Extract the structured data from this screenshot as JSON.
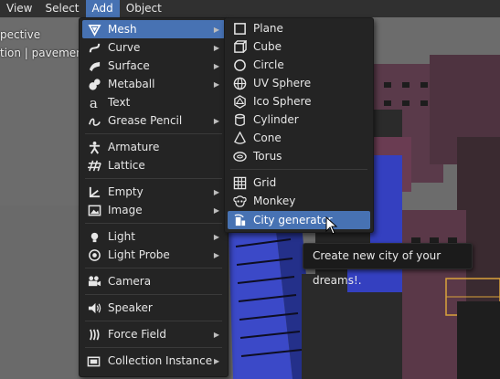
{
  "menubar": {
    "items": [
      {
        "label": "View",
        "active": false
      },
      {
        "label": "Select",
        "active": false
      },
      {
        "label": "Add",
        "active": true
      },
      {
        "label": "Object",
        "active": false
      }
    ]
  },
  "viewport": {
    "overlay_line1": "pective",
    "overlay_line2": "tion | pavement0"
  },
  "add_menu": {
    "items": [
      {
        "label": "Mesh",
        "icon": "mesh-icon",
        "submenu": true,
        "highlighted": true
      },
      {
        "label": "Curve",
        "icon": "curve-icon",
        "submenu": true
      },
      {
        "label": "Surface",
        "icon": "surface-icon",
        "submenu": true
      },
      {
        "label": "Metaball",
        "icon": "metaball-icon",
        "submenu": true
      },
      {
        "label": "Text",
        "icon": "text-icon",
        "submenu": false
      },
      {
        "label": "Grease Pencil",
        "icon": "grease-pencil-icon",
        "submenu": true
      },
      {
        "label": "Armature",
        "icon": "armature-icon",
        "submenu": false
      },
      {
        "label": "Lattice",
        "icon": "lattice-icon",
        "submenu": false
      },
      {
        "label": "Empty",
        "icon": "empty-icon",
        "submenu": true
      },
      {
        "label": "Image",
        "icon": "image-icon",
        "submenu": true
      },
      {
        "label": "Light",
        "icon": "light-icon",
        "submenu": true
      },
      {
        "label": "Light Probe",
        "icon": "light-probe-icon",
        "submenu": true
      },
      {
        "label": "Camera",
        "icon": "camera-icon",
        "submenu": false
      },
      {
        "label": "Speaker",
        "icon": "speaker-icon",
        "submenu": false
      },
      {
        "label": "Force Field",
        "icon": "force-field-icon",
        "submenu": true
      },
      {
        "label": "Collection Instance",
        "icon": "collection-instance-icon",
        "submenu": true
      }
    ]
  },
  "mesh_menu": {
    "items": [
      {
        "label": "Plane",
        "icon": "plane-icon"
      },
      {
        "label": "Cube",
        "icon": "cube-icon"
      },
      {
        "label": "Circle",
        "icon": "circle-icon"
      },
      {
        "label": "UV Sphere",
        "icon": "uv-sphere-icon"
      },
      {
        "label": "Ico Sphere",
        "icon": "ico-sphere-icon"
      },
      {
        "label": "Cylinder",
        "icon": "cylinder-icon"
      },
      {
        "label": "Cone",
        "icon": "cone-icon"
      },
      {
        "label": "Torus",
        "icon": "torus-icon"
      },
      {
        "label": "Grid",
        "icon": "grid-icon"
      },
      {
        "label": "Monkey",
        "icon": "monkey-icon"
      },
      {
        "label": "City generator",
        "icon": "city-generator-icon",
        "highlighted": true
      }
    ]
  },
  "tooltip": {
    "text": "Create new city of your dreams!."
  },
  "colors": {
    "accent": "#4772b3",
    "menu_bg": "#242424",
    "header_bg": "#303030"
  }
}
